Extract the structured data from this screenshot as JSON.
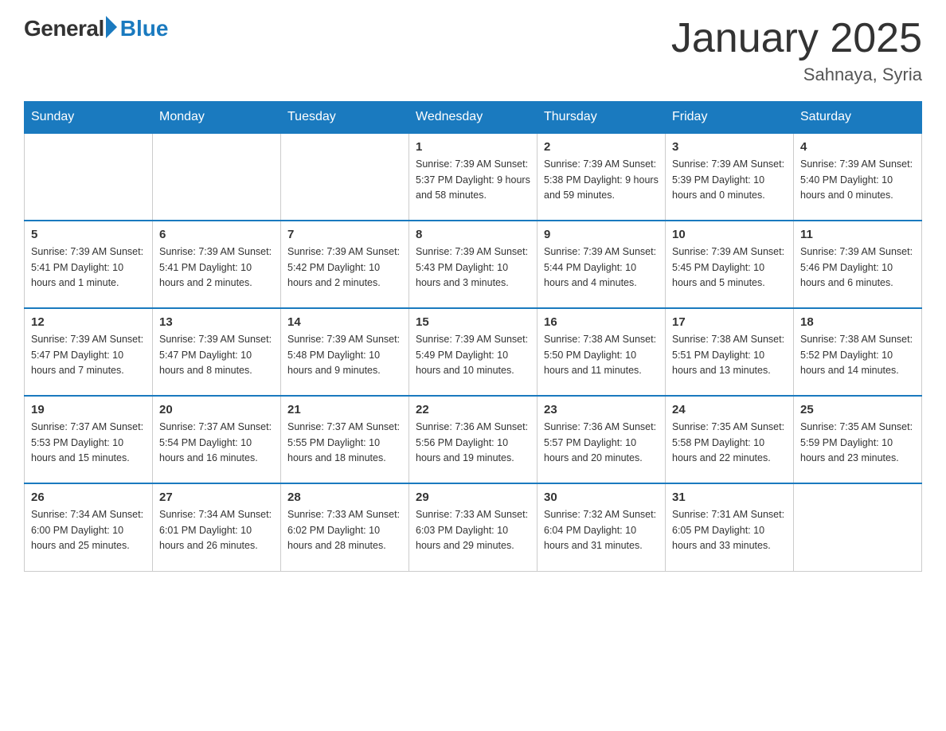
{
  "logo": {
    "general": "General",
    "blue": "Blue",
    "subtitle": ""
  },
  "title": "January 2025",
  "subtitle": "Sahnaya, Syria",
  "days_of_week": [
    "Sunday",
    "Monday",
    "Tuesday",
    "Wednesday",
    "Thursday",
    "Friday",
    "Saturday"
  ],
  "weeks": [
    [
      {
        "day": "",
        "info": ""
      },
      {
        "day": "",
        "info": ""
      },
      {
        "day": "",
        "info": ""
      },
      {
        "day": "1",
        "info": "Sunrise: 7:39 AM\nSunset: 5:37 PM\nDaylight: 9 hours\nand 58 minutes."
      },
      {
        "day": "2",
        "info": "Sunrise: 7:39 AM\nSunset: 5:38 PM\nDaylight: 9 hours\nand 59 minutes."
      },
      {
        "day": "3",
        "info": "Sunrise: 7:39 AM\nSunset: 5:39 PM\nDaylight: 10 hours\nand 0 minutes."
      },
      {
        "day": "4",
        "info": "Sunrise: 7:39 AM\nSunset: 5:40 PM\nDaylight: 10 hours\nand 0 minutes."
      }
    ],
    [
      {
        "day": "5",
        "info": "Sunrise: 7:39 AM\nSunset: 5:41 PM\nDaylight: 10 hours\nand 1 minute."
      },
      {
        "day": "6",
        "info": "Sunrise: 7:39 AM\nSunset: 5:41 PM\nDaylight: 10 hours\nand 2 minutes."
      },
      {
        "day": "7",
        "info": "Sunrise: 7:39 AM\nSunset: 5:42 PM\nDaylight: 10 hours\nand 2 minutes."
      },
      {
        "day": "8",
        "info": "Sunrise: 7:39 AM\nSunset: 5:43 PM\nDaylight: 10 hours\nand 3 minutes."
      },
      {
        "day": "9",
        "info": "Sunrise: 7:39 AM\nSunset: 5:44 PM\nDaylight: 10 hours\nand 4 minutes."
      },
      {
        "day": "10",
        "info": "Sunrise: 7:39 AM\nSunset: 5:45 PM\nDaylight: 10 hours\nand 5 minutes."
      },
      {
        "day": "11",
        "info": "Sunrise: 7:39 AM\nSunset: 5:46 PM\nDaylight: 10 hours\nand 6 minutes."
      }
    ],
    [
      {
        "day": "12",
        "info": "Sunrise: 7:39 AM\nSunset: 5:47 PM\nDaylight: 10 hours\nand 7 minutes."
      },
      {
        "day": "13",
        "info": "Sunrise: 7:39 AM\nSunset: 5:47 PM\nDaylight: 10 hours\nand 8 minutes."
      },
      {
        "day": "14",
        "info": "Sunrise: 7:39 AM\nSunset: 5:48 PM\nDaylight: 10 hours\nand 9 minutes."
      },
      {
        "day": "15",
        "info": "Sunrise: 7:39 AM\nSunset: 5:49 PM\nDaylight: 10 hours\nand 10 minutes."
      },
      {
        "day": "16",
        "info": "Sunrise: 7:38 AM\nSunset: 5:50 PM\nDaylight: 10 hours\nand 11 minutes."
      },
      {
        "day": "17",
        "info": "Sunrise: 7:38 AM\nSunset: 5:51 PM\nDaylight: 10 hours\nand 13 minutes."
      },
      {
        "day": "18",
        "info": "Sunrise: 7:38 AM\nSunset: 5:52 PM\nDaylight: 10 hours\nand 14 minutes."
      }
    ],
    [
      {
        "day": "19",
        "info": "Sunrise: 7:37 AM\nSunset: 5:53 PM\nDaylight: 10 hours\nand 15 minutes."
      },
      {
        "day": "20",
        "info": "Sunrise: 7:37 AM\nSunset: 5:54 PM\nDaylight: 10 hours\nand 16 minutes."
      },
      {
        "day": "21",
        "info": "Sunrise: 7:37 AM\nSunset: 5:55 PM\nDaylight: 10 hours\nand 18 minutes."
      },
      {
        "day": "22",
        "info": "Sunrise: 7:36 AM\nSunset: 5:56 PM\nDaylight: 10 hours\nand 19 minutes."
      },
      {
        "day": "23",
        "info": "Sunrise: 7:36 AM\nSunset: 5:57 PM\nDaylight: 10 hours\nand 20 minutes."
      },
      {
        "day": "24",
        "info": "Sunrise: 7:35 AM\nSunset: 5:58 PM\nDaylight: 10 hours\nand 22 minutes."
      },
      {
        "day": "25",
        "info": "Sunrise: 7:35 AM\nSunset: 5:59 PM\nDaylight: 10 hours\nand 23 minutes."
      }
    ],
    [
      {
        "day": "26",
        "info": "Sunrise: 7:34 AM\nSunset: 6:00 PM\nDaylight: 10 hours\nand 25 minutes."
      },
      {
        "day": "27",
        "info": "Sunrise: 7:34 AM\nSunset: 6:01 PM\nDaylight: 10 hours\nand 26 minutes."
      },
      {
        "day": "28",
        "info": "Sunrise: 7:33 AM\nSunset: 6:02 PM\nDaylight: 10 hours\nand 28 minutes."
      },
      {
        "day": "29",
        "info": "Sunrise: 7:33 AM\nSunset: 6:03 PM\nDaylight: 10 hours\nand 29 minutes."
      },
      {
        "day": "30",
        "info": "Sunrise: 7:32 AM\nSunset: 6:04 PM\nDaylight: 10 hours\nand 31 minutes."
      },
      {
        "day": "31",
        "info": "Sunrise: 7:31 AM\nSunset: 6:05 PM\nDaylight: 10 hours\nand 33 minutes."
      },
      {
        "day": "",
        "info": ""
      }
    ]
  ]
}
